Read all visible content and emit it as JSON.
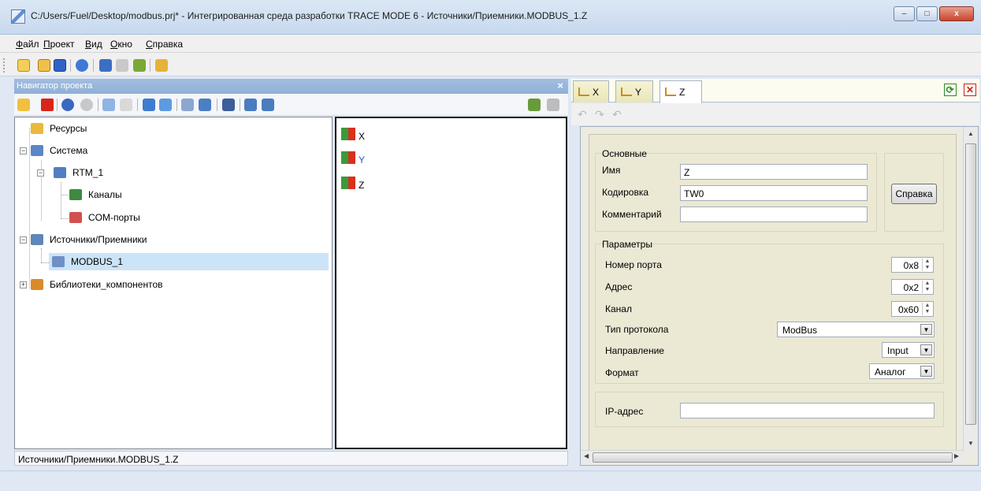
{
  "window": {
    "title": "C:/Users/Fuel/Desktop/modbus.prj* - Интегрированная среда разработки TRACE MODE 6 - Источники/Приемники.MODBUS_1.Z",
    "minimize_label": "–",
    "maximize_label": "□",
    "close_label": "x"
  },
  "menu": [
    "Файл",
    "Проект",
    "Вид",
    "Окно",
    "Справка"
  ],
  "navigator": {
    "title": "Навигатор проекта",
    "close_label": "×",
    "tree": [
      {
        "label": "Ресурсы"
      },
      {
        "label": "Система"
      },
      {
        "label": "RTM_1"
      },
      {
        "label": "Каналы"
      },
      {
        "label": "COM-порты"
      },
      {
        "label": "Источники/Приемники"
      },
      {
        "label": "MODBUS_1",
        "selected": true
      },
      {
        "label": "Библиотеки_компонентов"
      }
    ],
    "list": [
      "X",
      "Y",
      "Z"
    ],
    "status_path": "Источники/Приемники.MODBUS_1.Z"
  },
  "editor": {
    "tabs": [
      {
        "label": "X"
      },
      {
        "label": "Y"
      },
      {
        "label": "Z",
        "active": true
      }
    ],
    "tool_refresh": "⟳",
    "tool_close": "✕",
    "basic": {
      "title": "Основные",
      "name_label": "Имя",
      "name_value": "Z",
      "code_label": "Кодировка",
      "code_value": "TW0",
      "comment_label": "Комментарий",
      "comment_value": ""
    },
    "help_button": "Справка",
    "params": {
      "title": "Параметры",
      "port_label": "Номер порта",
      "port_value": "0x8",
      "address_label": "Адрес",
      "address_value": "0x2",
      "channel_label": "Канал",
      "channel_value": "0x60",
      "protocol_label": "Тип протокола",
      "protocol_value": "ModBus",
      "direction_label": "Направление",
      "direction_value": "Input",
      "format_label": "Формат",
      "format_value": "Аналог"
    },
    "ip": {
      "label": "IP-адрес",
      "value": ""
    }
  }
}
